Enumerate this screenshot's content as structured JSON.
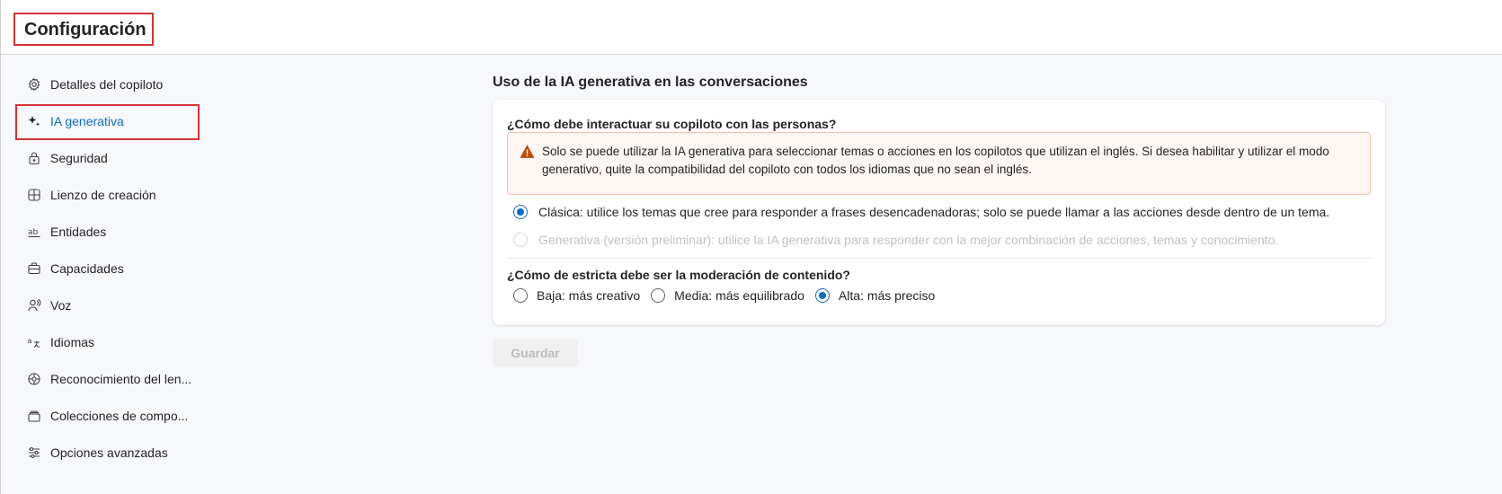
{
  "header": {
    "title": "Configuración"
  },
  "sidebar": {
    "items": [
      {
        "label": "Detalles del copiloto",
        "icon": "gear-icon"
      },
      {
        "label": "IA generativa",
        "icon": "sparkle-icon",
        "active": true
      },
      {
        "label": "Seguridad",
        "icon": "lock-icon"
      },
      {
        "label": "Lienzo de creación",
        "icon": "grid-icon"
      },
      {
        "label": "Entidades",
        "icon": "entity-ab-icon"
      },
      {
        "label": "Capacidades",
        "icon": "briefcase-icon"
      },
      {
        "label": "Voz",
        "icon": "voice-person-icon"
      },
      {
        "label": "Idiomas",
        "icon": "translate-icon"
      },
      {
        "label": "Reconocimiento del len...",
        "icon": "language-understanding-icon"
      },
      {
        "label": "Colecciones de compo...",
        "icon": "collection-icon"
      },
      {
        "label": "Opciones avanzadas",
        "icon": "sliders-icon"
      }
    ]
  },
  "main": {
    "section_title": "Uso de la IA generativa en las conversaciones",
    "interaction_question": "¿Cómo debe interactuar su copiloto con las personas?",
    "warning": {
      "icon": "warning-icon",
      "text": "Solo se puede utilizar la IA generativa para seleccionar temas o acciones en los copilotos que utilizan el inglés. Si desea habilitar y utilizar el modo generativo, quite la compatibilidad del copiloto con todos los idiomas que no sean el inglés."
    },
    "interaction_options": [
      {
        "label": "Clásica: utilice los temas que cree para responder a frases desencadenadoras; solo se puede llamar a las acciones desde dentro de un tema.",
        "checked": true,
        "disabled": false
      },
      {
        "label": "Generativa (versión preliminar): utilice la IA generativa para responder con la mejor combinación de acciones, temas y conocimiento.",
        "checked": false,
        "disabled": true
      }
    ],
    "moderation_question": "¿Cómo de estricta debe ser la moderación de contenido?",
    "moderation_options": [
      {
        "label": "Baja: más creativo",
        "checked": false
      },
      {
        "label": "Media: más equilibrado",
        "checked": false
      },
      {
        "label": "Alta: más preciso",
        "checked": true
      }
    ],
    "save_label": "Guardar"
  },
  "colors": {
    "accent": "#0f6cbd",
    "highlight_frame": "#d13438",
    "warning_icon": "#bc4b09",
    "warning_bg": "#fdf6f3"
  }
}
